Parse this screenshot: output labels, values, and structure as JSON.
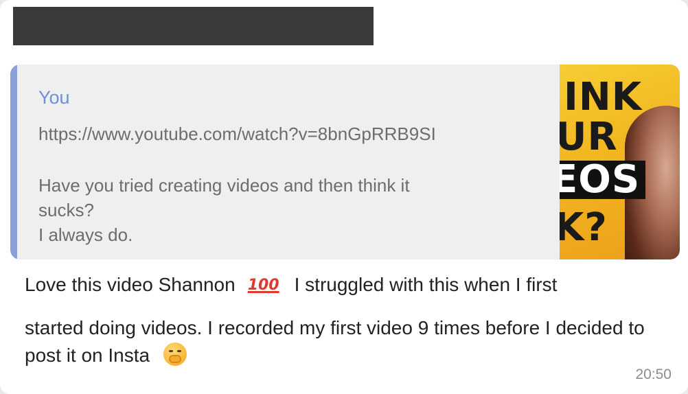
{
  "quote": {
    "author": "You",
    "link": "https://www.youtube.com/watch?v=8bnGpRRB9SI",
    "text": "Have you tried creating videos and then think it\nsucks?\nI always do."
  },
  "thumbnail": {
    "line1": "INK",
    "line2": "UR",
    "line3": "EOS",
    "line4": "K?",
    "accent_color": "#f5c02b"
  },
  "message": {
    "part1": "Love this video Shannon",
    "emoji1": "100",
    "part2": "I struggled with this when I first",
    "part3": "started doing videos. I recorded my first video 9 times before I decided to post it on Insta",
    "emoji2_icon": "hand-over-mouth-emoji"
  },
  "timestamp": "20:50",
  "colors": {
    "quote_bar": "#8aa0d6",
    "quote_author": "#6f8fd8",
    "quote_background": "#efefef",
    "sender_redacted": "#3a3a3a"
  }
}
